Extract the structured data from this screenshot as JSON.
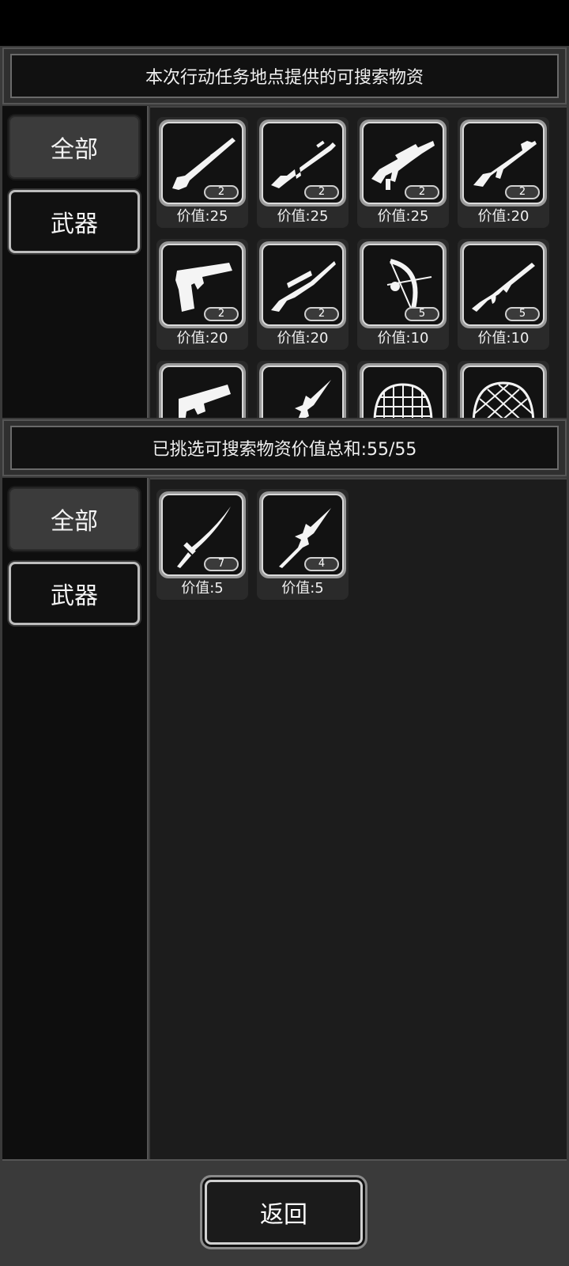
{
  "top_section": {
    "title": "本次行动任务地点提供的可搜索物资",
    "tabs": [
      {
        "label": "全部",
        "active": true
      },
      {
        "label": "武器",
        "active": false
      }
    ],
    "items": [
      {
        "icon": "shotgun-icon",
        "count": "2",
        "value": "价值:25"
      },
      {
        "icon": "assault-rifle-icon",
        "count": "2",
        "value": "价值:25"
      },
      {
        "icon": "bullpup-rifle-icon",
        "count": "2",
        "value": "价值:25"
      },
      {
        "icon": "m16-rifle-icon",
        "count": "2",
        "value": "价值:20"
      },
      {
        "icon": "pistol-icon",
        "count": "2",
        "value": "价值:20"
      },
      {
        "icon": "sniper-rifle-icon",
        "count": "2",
        "value": "价值:20"
      },
      {
        "icon": "compound-bow-icon",
        "count": "5",
        "value": "价值:10"
      },
      {
        "icon": "ak-rifle-icon",
        "count": "5",
        "value": "价值:10"
      },
      {
        "icon": "handgun-icon",
        "count": "",
        "value": ""
      },
      {
        "icon": "spear-icon",
        "count": "",
        "value": ""
      },
      {
        "icon": "helmet-icon",
        "count": "",
        "value": ""
      },
      {
        "icon": "net-helmet-icon",
        "count": "",
        "value": ""
      }
    ]
  },
  "bottom_section": {
    "title": "已挑选可搜索物资价值总和:55/55",
    "tabs": [
      {
        "label": "全部",
        "active": true
      },
      {
        "label": "武器",
        "active": false
      }
    ],
    "items": [
      {
        "icon": "katana-icon",
        "count": "7",
        "value": "价值:5"
      },
      {
        "icon": "spear-icon",
        "count": "4",
        "value": "价值:5"
      }
    ]
  },
  "footer": {
    "back_label": "返回"
  }
}
